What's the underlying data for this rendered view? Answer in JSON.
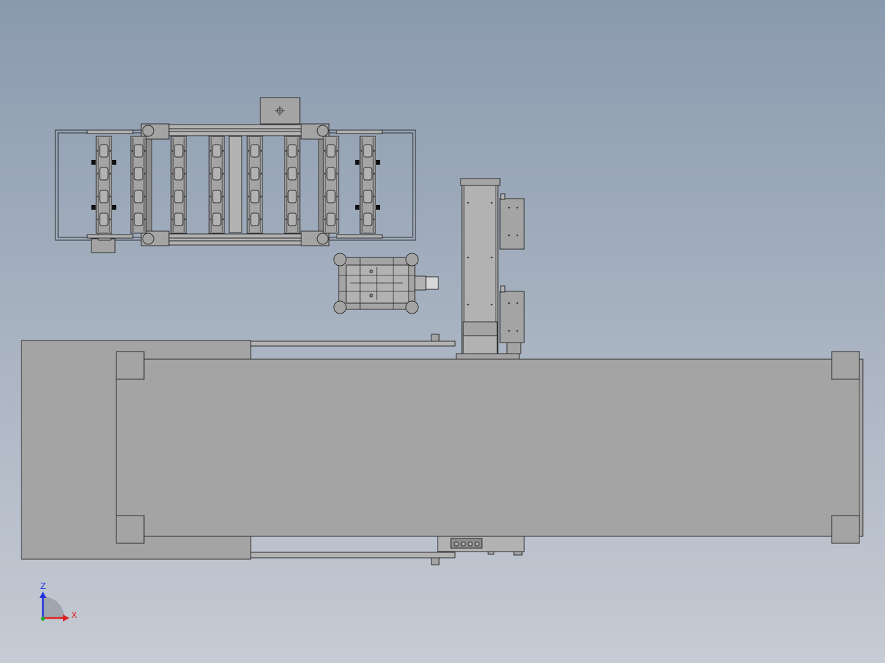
{
  "viewport": {
    "background_top": "#8a9aae",
    "background_bottom": "#c6cbd4"
  },
  "palette": {
    "part_fill": "#a4a4a4",
    "part_fill_light": "#b2b2b2",
    "part_fill_dark": "#8c8c8c",
    "edge": "#2a2a2a",
    "slot_dark": "#3c3c3c"
  },
  "triad": {
    "z_label": "Z",
    "x_label": "X",
    "z_color": "#2233dd",
    "x_color": "#dd2222",
    "y_color": "#22aa33"
  }
}
